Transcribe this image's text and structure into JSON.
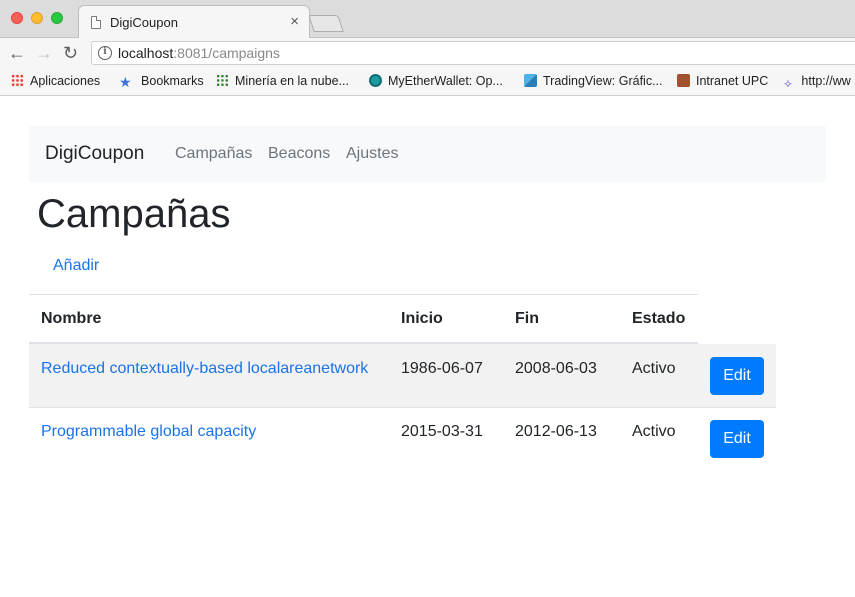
{
  "browser": {
    "tab_title": "DigiCoupon",
    "tab_close": "×",
    "url_host": "localhost",
    "url_rest": ":8081/campaigns",
    "info_glyph": "i",
    "bookmarks": [
      {
        "label": "Aplicaciones",
        "icon": "apps-grid-icon"
      },
      {
        "label": "Bookmarks",
        "icon": "star-icon"
      },
      {
        "label": "Minería en la nube...",
        "icon": "grid-icon"
      },
      {
        "label": "MyEtherWallet: Op...",
        "icon": "ether-icon"
      },
      {
        "label": "TradingView: Gráfic...",
        "icon": "tradingview-icon"
      },
      {
        "label": "Intranet UPC",
        "icon": "avatar-icon"
      },
      {
        "label": "http://ww",
        "icon": "link-icon"
      }
    ]
  },
  "navbar": {
    "brand": "DigiCoupon",
    "links": [
      "Campañas",
      "Beacons",
      "Ajustes"
    ]
  },
  "page": {
    "title": "Campañas",
    "add_link": "Añadir"
  },
  "table": {
    "headers": [
      "Nombre",
      "Inicio",
      "Fin",
      "Estado"
    ],
    "rows": [
      {
        "name": "Reduced contextually-based localareanetwork",
        "start": "1986-06-07",
        "end": "2008-06-03",
        "status": "Activo",
        "action": "Edit"
      },
      {
        "name": "Programmable global capacity",
        "start": "2015-03-31",
        "end": "2012-06-13",
        "status": "Activo",
        "action": "Edit"
      }
    ]
  },
  "colors": {
    "primary": "#007bff",
    "link": "#1a73e8",
    "navbar_bg": "#f8f9fa",
    "stripe": "#f2f2f2"
  }
}
